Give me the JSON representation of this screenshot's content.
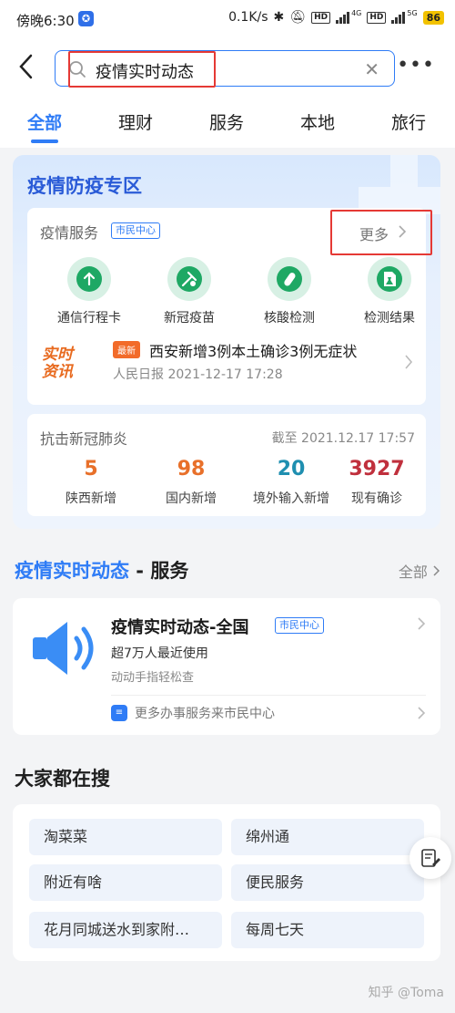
{
  "status_bar": {
    "time": "傍晚6:30",
    "net_speed": "0.1K/s",
    "net_4g": "4G",
    "net_5g": "5G",
    "hd": "HD",
    "battery": "86"
  },
  "search": {
    "query": "疫情实时动态",
    "clear_glyph": "✕"
  },
  "tabs": [
    {
      "label": "全部",
      "active": true
    },
    {
      "label": "理财"
    },
    {
      "label": "服务"
    },
    {
      "label": "本地"
    },
    {
      "label": "旅行"
    }
  ],
  "epidemic_zone": {
    "title": "疫情防疫专区",
    "services_header": "疫情服务",
    "services_tag": "市民中心",
    "more_label": "更多",
    "services": [
      {
        "label": "通信行程卡",
        "icon": "arrow-up-icon"
      },
      {
        "label": "新冠疫苗",
        "icon": "vaccine-icon"
      },
      {
        "label": "核酸检测",
        "icon": "test-tube-icon"
      },
      {
        "label": "检测结果",
        "icon": "flask-doc-icon"
      }
    ],
    "news": {
      "logo_line1": "实时",
      "logo_line2": "资讯",
      "badge": "最新",
      "title": "西安新增3例本土确诊3例无症状",
      "source": "人民日报   2021-12-17 17:28"
    },
    "stats": {
      "title": "抗击新冠肺炎",
      "as_of": "截至 2021.12.17 17:57",
      "items": [
        {
          "value": "5",
          "label": "陕西新增",
          "color": "#e8702a"
        },
        {
          "value": "98",
          "label": "国内新增",
          "color": "#e8702a"
        },
        {
          "value": "20",
          "label": "境外输入新增",
          "color": "#1f8fb0"
        },
        {
          "value": "3927",
          "label": "现有确诊",
          "color": "#c0303d"
        }
      ]
    }
  },
  "service_section": {
    "title_blue": "疫情实时动态",
    "title_rest": " - 服务",
    "all_label": "全部",
    "card": {
      "title": "疫情实时动态-全国",
      "tag": "市民中心",
      "sub1": "超7万人最近使用",
      "sub2": "动动手指轻松查",
      "more_icon_text": "≡",
      "more": "更多办事服务来市民中心"
    }
  },
  "trending": {
    "title": "大家都在搜",
    "items": [
      "淘菜菜",
      "绵州通",
      "附近有啥",
      "便民服务",
      "花月同城送水到家附…",
      "每周七天"
    ]
  },
  "watermark": "知乎 @Toma",
  "colors": {
    "accent": "#2f7cf6",
    "highlight_box": "#e53935",
    "green": "#1ea864"
  }
}
